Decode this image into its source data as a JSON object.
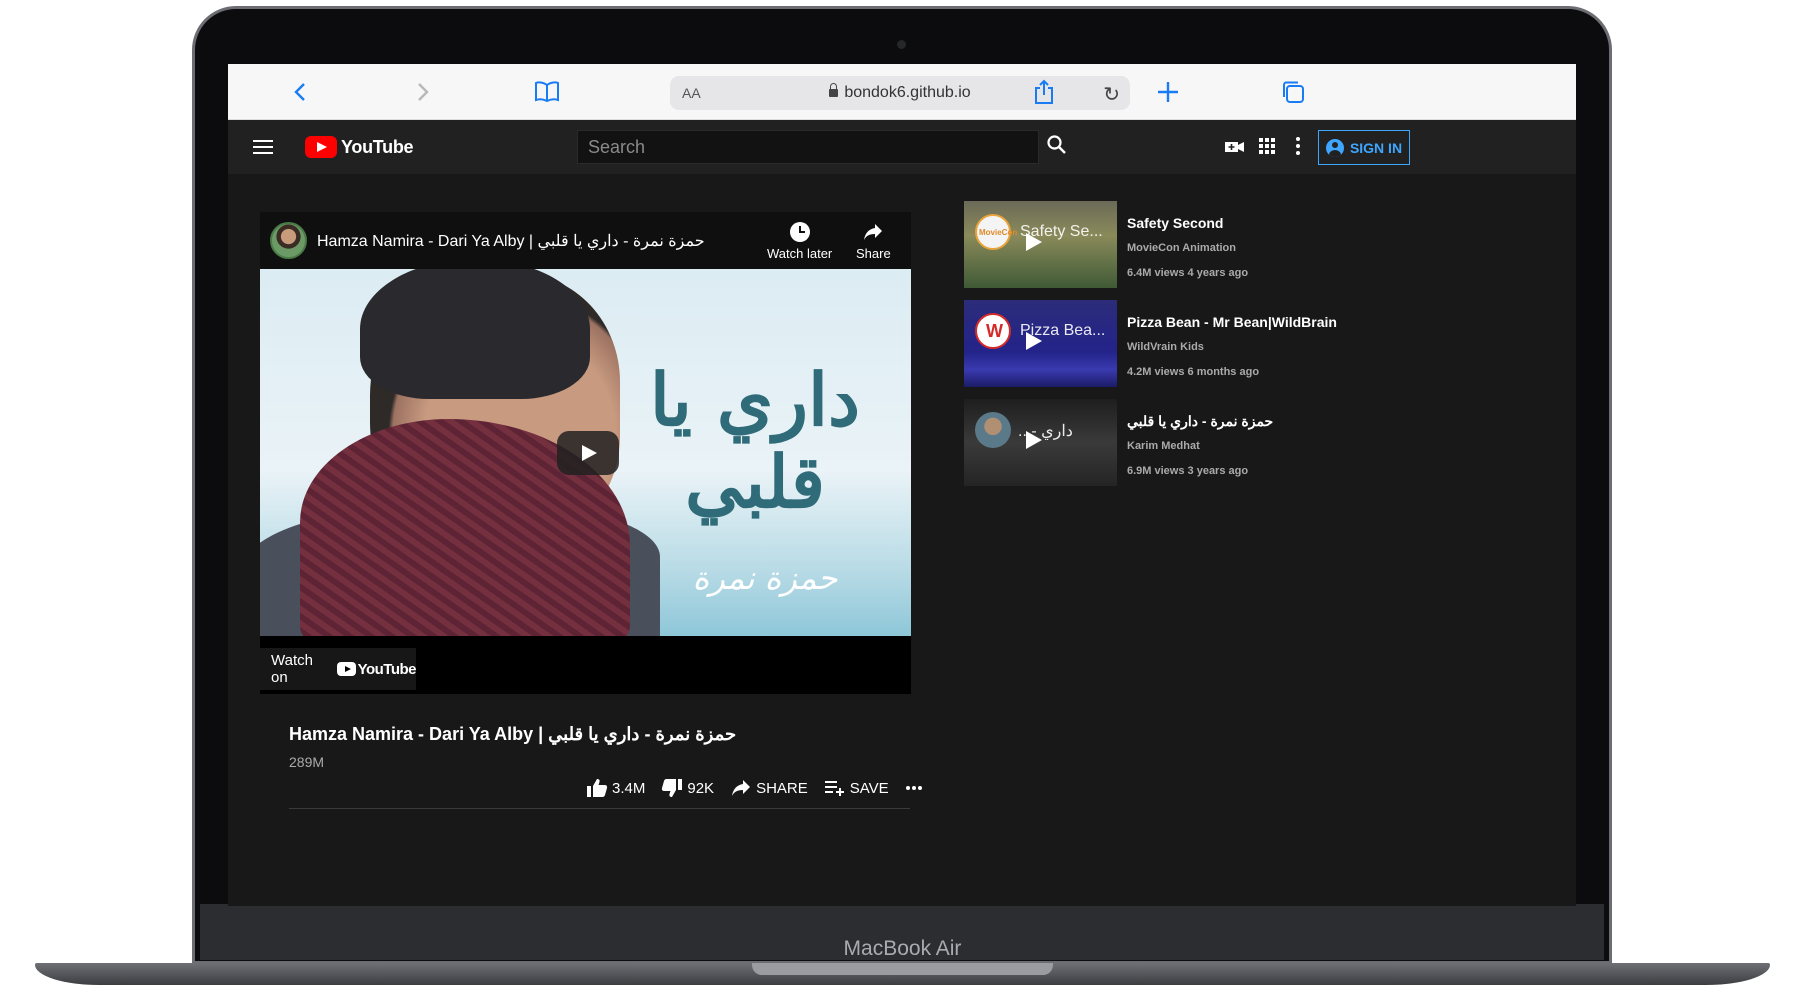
{
  "device": {
    "model_label": "MacBook Air"
  },
  "browser": {
    "text_size_label": "AA",
    "url": "bondok6.github.io",
    "icons": [
      "back-icon",
      "forward-icon",
      "bookmarks-icon",
      "reload-icon",
      "share-icon",
      "new-tab-icon",
      "tabs-icon"
    ]
  },
  "header": {
    "logo_text": "YouTube",
    "search_placeholder": "Search",
    "sign_in_label": "SIGN IN",
    "colors": {
      "accent": "#3ea6ff",
      "brand": "#ff0000",
      "bg": "#212121"
    }
  },
  "player": {
    "title": "Hamza Namira - Dari Ya Alby | حمزة نمرة - داري يا قلبي",
    "watch_later_label": "Watch later",
    "share_label": "Share",
    "thumbnail_title": "داري يا قلبي",
    "thumbnail_signature": "حمزة نمرة",
    "watch_on_label": "Watch on",
    "watch_on_brand": "YouTube"
  },
  "video": {
    "title": "Hamza Namira - Dari Ya Alby | حمزة نمرة - داري يا قلبي",
    "views": "289M",
    "likes": "3.4M",
    "dislikes": "92K",
    "share_label": "SHARE",
    "save_label": "SAVE"
  },
  "related": [
    {
      "title": "Safety Second",
      "overlay_title": "Safety Se...",
      "channel": "MovieCon Animation",
      "meta": "6.4M views 4 years ago",
      "badge_text": "MovieCon"
    },
    {
      "title": "Pizza Bean - Mr Bean|WildBrain",
      "overlay_title": "Pizza Bea...",
      "channel": "WildVrain Kids",
      "meta": "4.2M views 6 months ago",
      "badge_text": "W"
    },
    {
      "title": "حمزة نمرة - داري يا قلبي",
      "overlay_title": "داري -...",
      "channel": "Karim Medhat",
      "meta": "6.9M views 3 years ago",
      "badge_text": ""
    }
  ]
}
